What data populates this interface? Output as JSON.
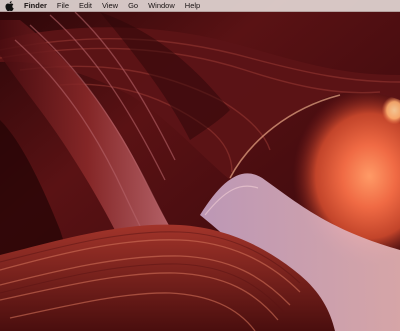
{
  "desktop": {
    "wallpaper": "sandstone-canyon",
    "colors": {
      "shadow": "#2a0608",
      "deep_red": "#7a1e1c",
      "rust": "#c2442a",
      "glow": "#f07a4e",
      "light": "#ffb88a",
      "lavender": "#c9a7c8"
    }
  },
  "menubar": {
    "apple_icon": "apple-icon",
    "app_name": "Finder",
    "items": [
      "File",
      "Edit",
      "View",
      "Go",
      "Window",
      "Help"
    ]
  }
}
